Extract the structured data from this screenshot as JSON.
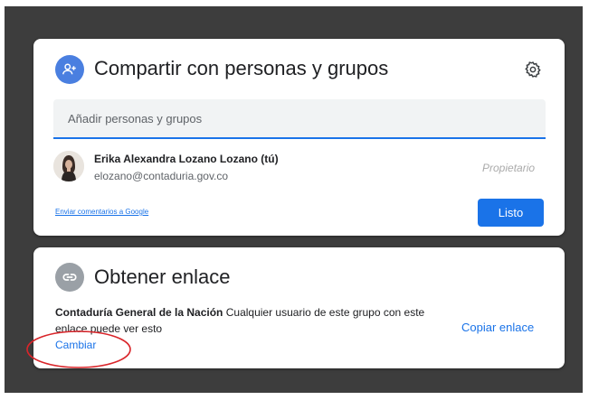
{
  "share_dialog": {
    "title": "Compartir con personas y grupos",
    "add_people_placeholder": "Añadir personas y grupos",
    "user": {
      "name": "Erika Alexandra Lozano Lozano (tú)",
      "email": "elozano@contaduria.gov.co",
      "role": "Propietario"
    },
    "feedback_link": "Enviar comentarios a Google",
    "done_label": "Listo",
    "icons": {
      "title_icon": "person-add-icon",
      "settings": "gear-icon"
    }
  },
  "link_dialog": {
    "title": "Obtener enlace",
    "org_name": "Contaduría General de la Nación",
    "description": "Cualquier usuario de este grupo con este enlace puede ver esto",
    "change_label": "Cambiar",
    "copy_label": "Copiar enlace",
    "icons": {
      "title_icon": "link-icon"
    }
  },
  "annotation": {
    "color": "#d9252a"
  },
  "colors": {
    "accent": "#1a73e8",
    "share_icon_bg": "#4a7fe0",
    "link_icon_bg": "#9aa0a6",
    "backdrop": "#3d3d3d"
  }
}
